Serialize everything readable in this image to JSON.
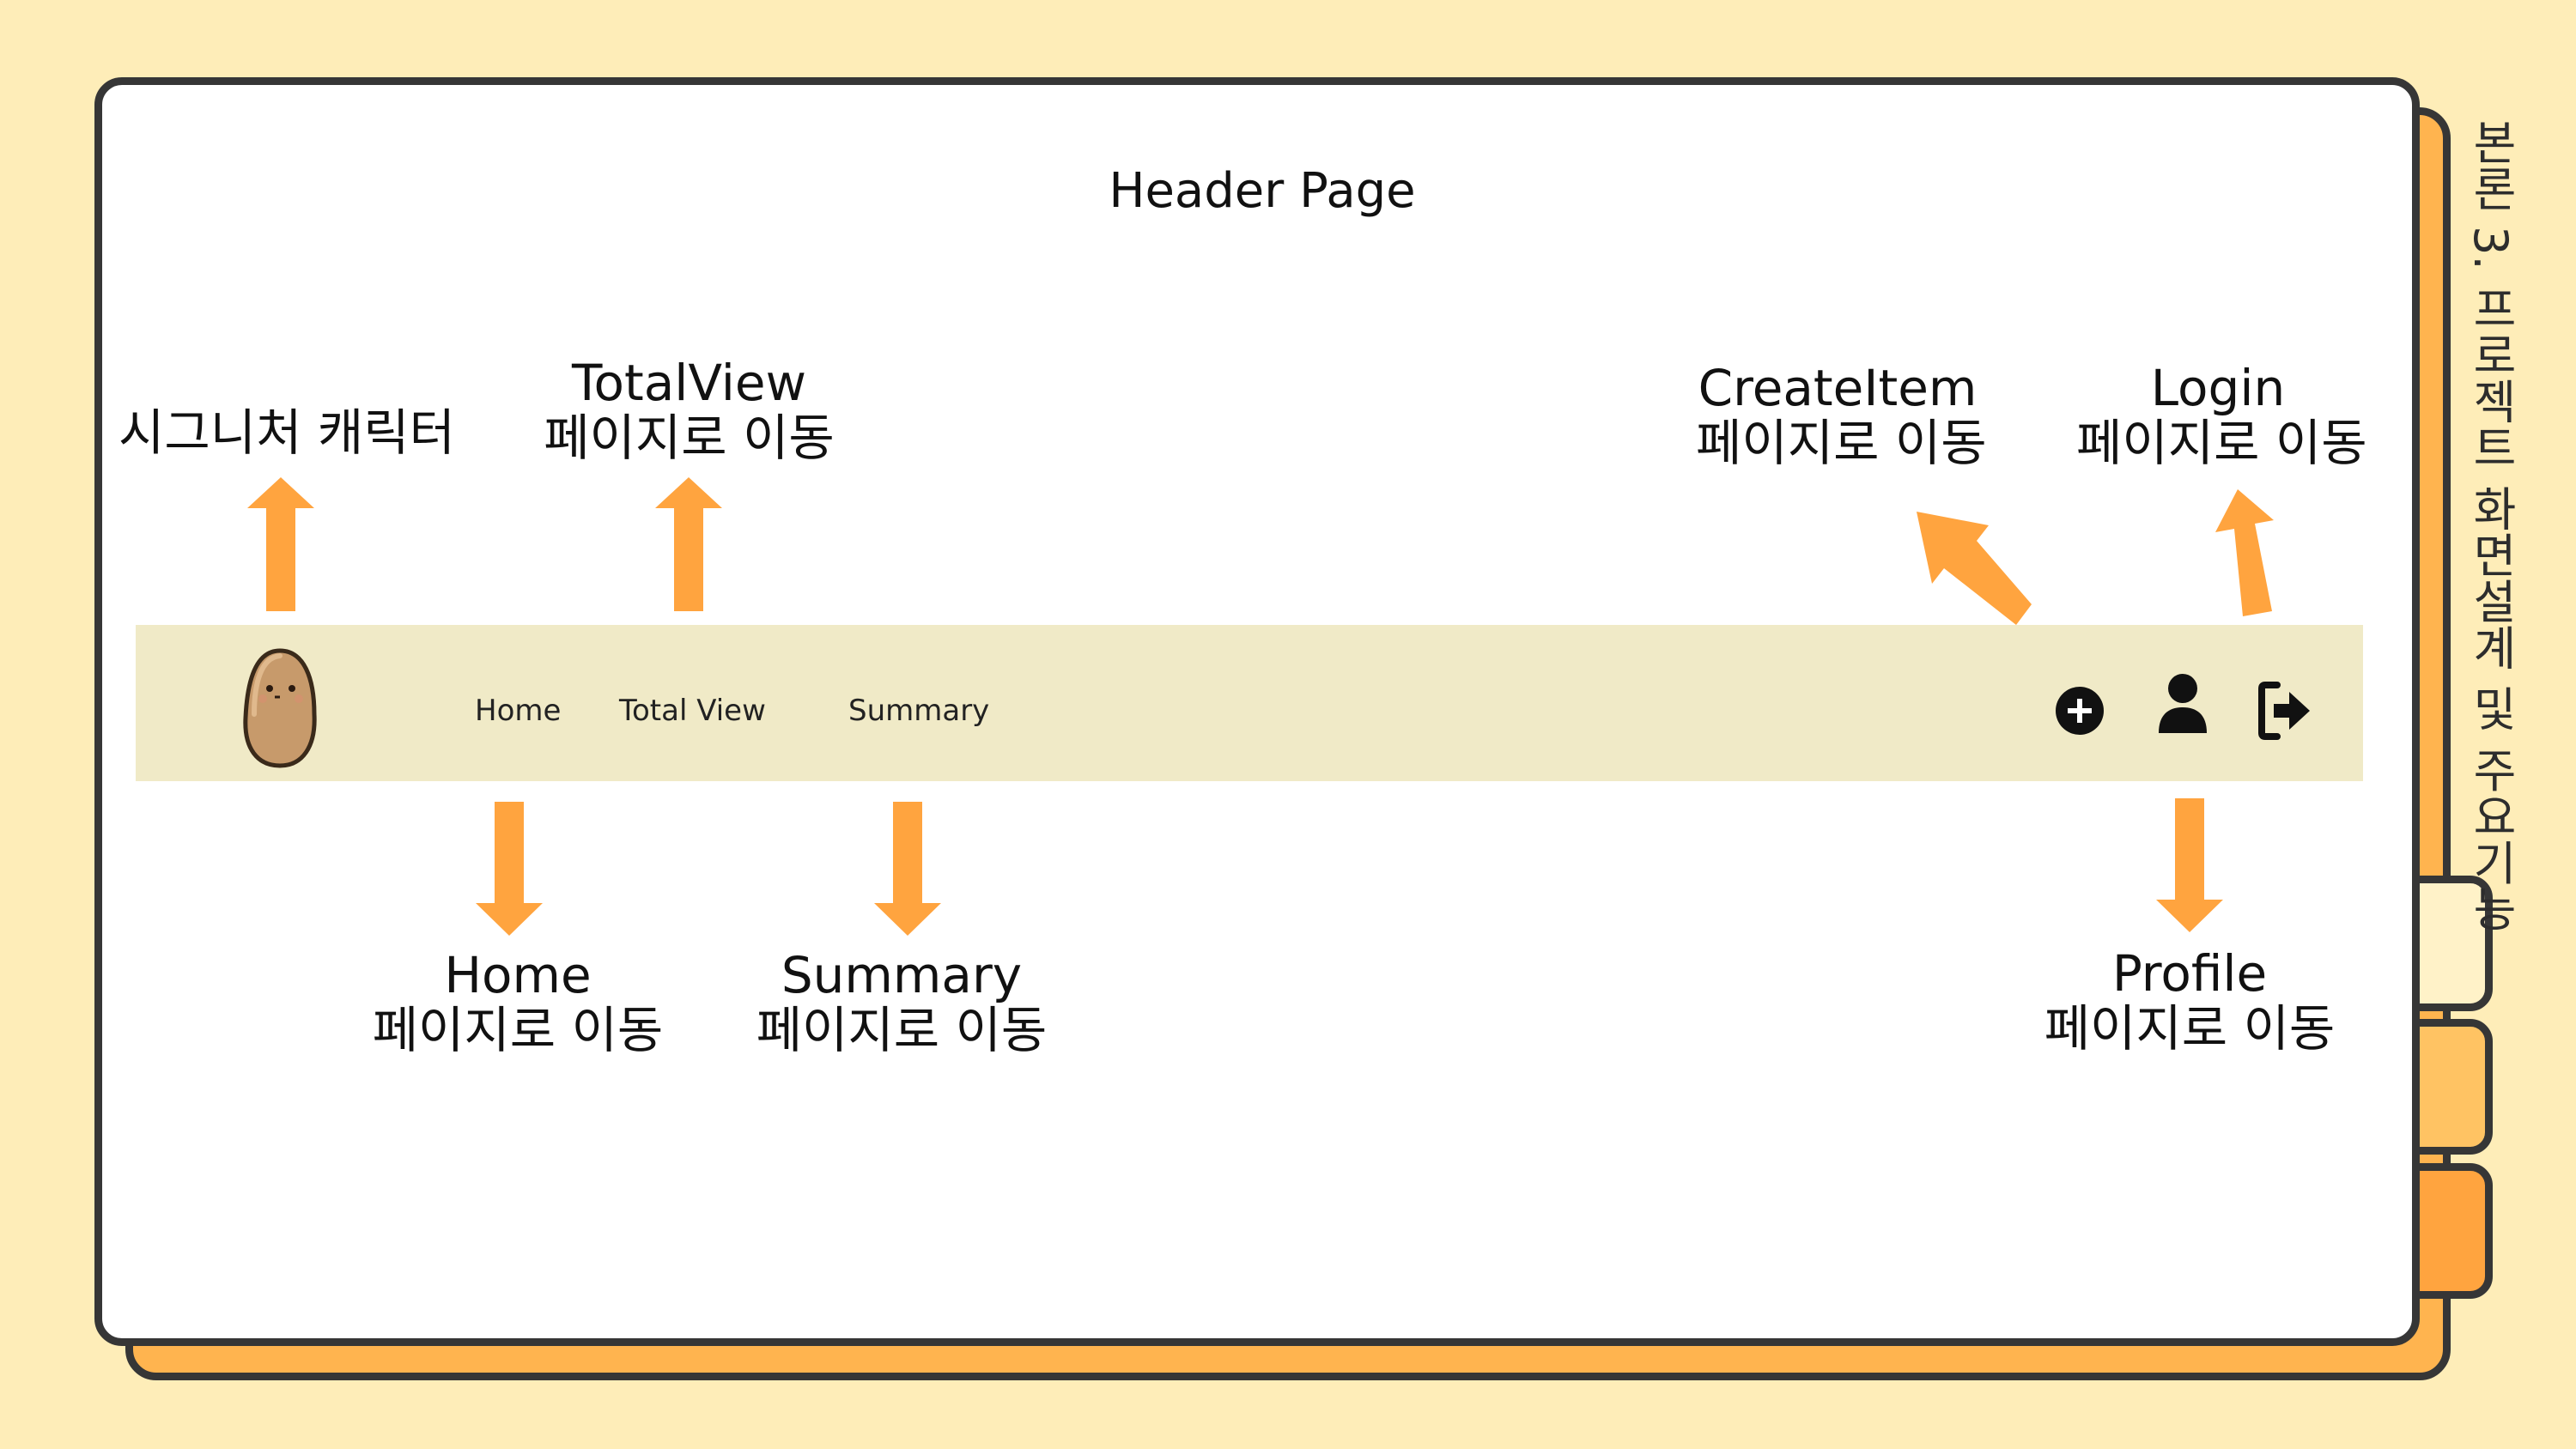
{
  "slide": {
    "section_title": "본론 3. 프로젝트 화면설계 및 주요기능",
    "page_title": "Header Page"
  },
  "header": {
    "nav": {
      "home": "Home",
      "total_view": "Total View",
      "summary": "Summary"
    },
    "icons": [
      "potato-character",
      "plus-circle-icon",
      "user-icon",
      "logout-icon"
    ]
  },
  "annotations": {
    "character": {
      "line1": "시그니처 캐릭터"
    },
    "totalview": {
      "line1": "TotalView",
      "line2": "페이지로 이동"
    },
    "createitem": {
      "line1": "CreateItem",
      "line2": "페이지로 이동"
    },
    "login": {
      "line1": "Login",
      "line2": "페이지로 이동"
    },
    "home": {
      "line1": "Home",
      "line2": "페이지로 이동"
    },
    "summary": {
      "line1": "Summary",
      "line2": "페이지로 이동"
    },
    "profile": {
      "line1": "Profile",
      "line2": "페이지로 이동"
    }
  },
  "colors": {
    "background": "#FEEDB8",
    "arrow": "#FFA43F",
    "header_bar": "#F0EAC7",
    "card_border": "#363636"
  }
}
